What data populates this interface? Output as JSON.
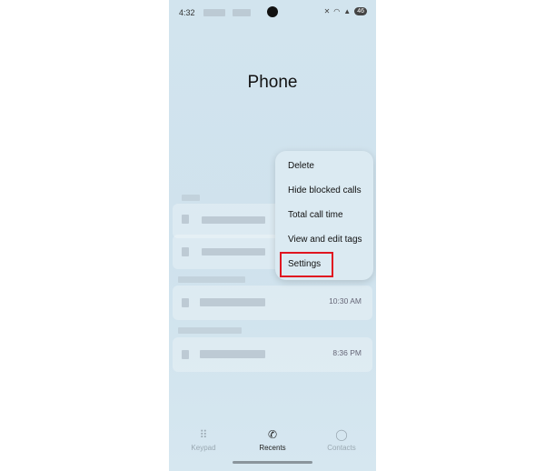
{
  "status_bar": {
    "time": "4:32",
    "battery": "46"
  },
  "header": {
    "title": "Phone"
  },
  "calls": [
    {
      "time": ""
    },
    {
      "time": ""
    },
    {
      "time": "10:30 AM"
    },
    {
      "time": "8:36 PM"
    }
  ],
  "menu": {
    "items": [
      "Delete",
      "Hide blocked calls",
      "Total call time",
      "View and edit tags",
      "Settings"
    ],
    "highlighted": "Settings",
    "highlight_color": "#e01520"
  },
  "bottom_nav": {
    "items": [
      {
        "label": "Keypad",
        "icon": "keypad-icon"
      },
      {
        "label": "Recents",
        "icon": "recents-phone-icon",
        "active": true
      },
      {
        "label": "Contacts",
        "icon": "person-icon"
      }
    ]
  }
}
